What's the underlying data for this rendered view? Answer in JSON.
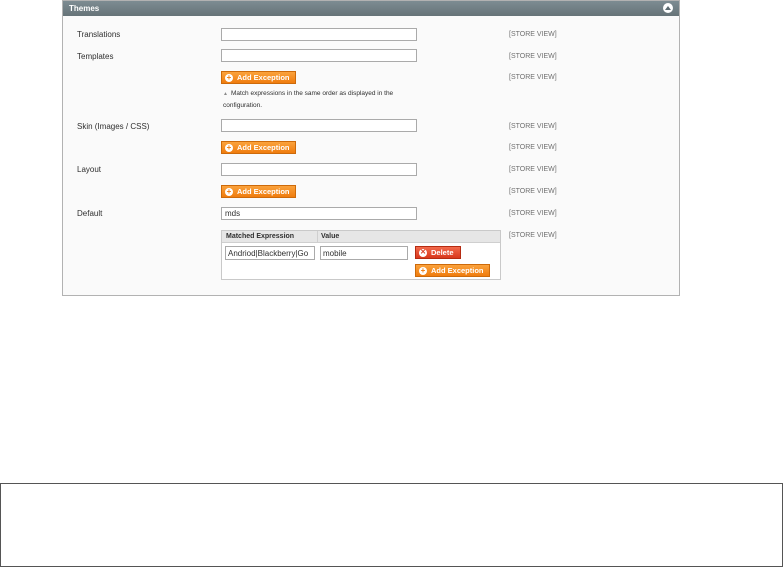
{
  "section": {
    "title": "Themes"
  },
  "rows": {
    "translations": {
      "label": "Translations",
      "value": "",
      "scope": "[STORE VIEW]"
    },
    "templates": {
      "label": "Templates",
      "value": "",
      "scope": "[STORE VIEW]",
      "button_scope": "[STORE VIEW]"
    },
    "skin": {
      "label": "Skin (Images / CSS)",
      "value": "",
      "scope": "[STORE VIEW]",
      "button_scope": "[STORE VIEW]"
    },
    "layout": {
      "label": "Layout",
      "value": "",
      "scope": "[STORE VIEW]",
      "button_scope": "[STORE VIEW]"
    },
    "default": {
      "label": "Default",
      "value": "mds",
      "scope": "[STORE VIEW]",
      "table_scope": "[STORE VIEW]"
    }
  },
  "buttons": {
    "add_exception": "Add Exception",
    "delete": "Delete"
  },
  "note": {
    "text": "Match expressions in the same order as displayed in the configuration."
  },
  "exceptions_table": {
    "columns": [
      "Matched Expression",
      "Value"
    ],
    "rows": [
      {
        "matched_expression": "Andriod|Blackberry|Go",
        "value": "mobile"
      }
    ]
  },
  "icons": {
    "collapse": "chevron-up-icon",
    "add": "plus-circle-icon",
    "delete": "x-circle-icon"
  },
  "colors": {
    "header": "#6f7d83",
    "button_orange": "#f07c0e",
    "button_delete": "#d9381c"
  }
}
